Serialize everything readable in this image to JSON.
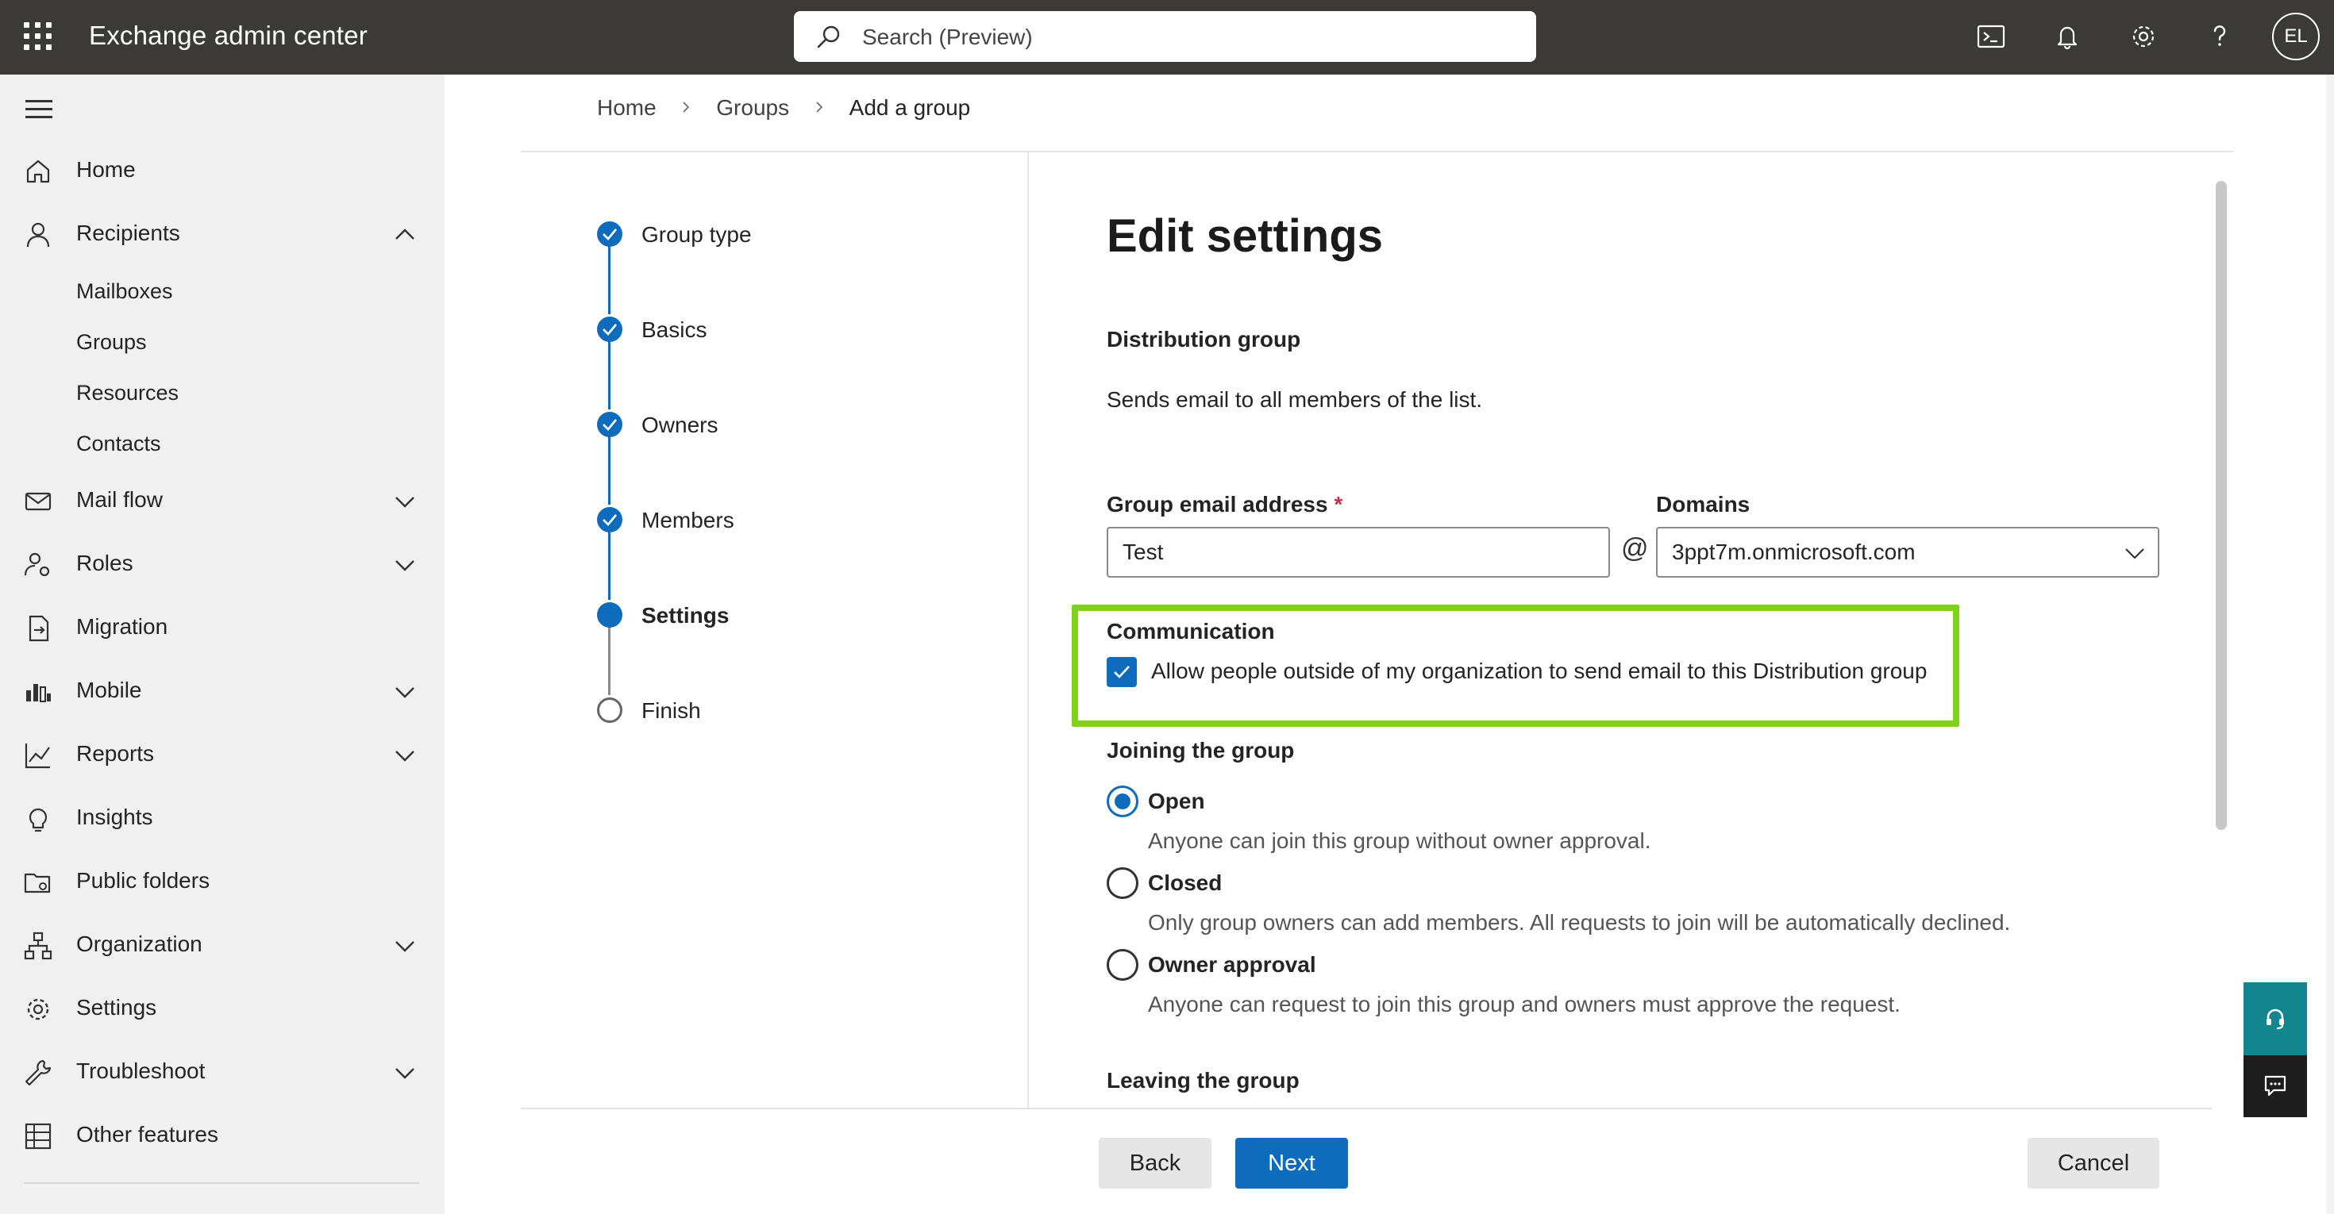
{
  "app": {
    "title": "Exchange admin center",
    "search_placeholder": "Search (Preview)",
    "user_initials": "EL",
    "accent_color": "#0f6cbd",
    "highlight_color": "#7fd11a"
  },
  "topbar_icons": [
    "terminal-icon",
    "bell-icon",
    "gear-icon",
    "help-icon"
  ],
  "sidebar": {
    "items": [
      {
        "label": "Home",
        "icon": "home-icon",
        "expandable": false
      },
      {
        "label": "Recipients",
        "icon": "person-icon",
        "expandable": true,
        "expanded": true,
        "children": [
          "Mailboxes",
          "Groups",
          "Resources",
          "Contacts"
        ]
      },
      {
        "label": "Mail flow",
        "icon": "mail-icon",
        "expandable": true
      },
      {
        "label": "Roles",
        "icon": "roles-icon",
        "expandable": true
      },
      {
        "label": "Migration",
        "icon": "migration-icon",
        "expandable": false
      },
      {
        "label": "Mobile",
        "icon": "mobile-icon",
        "expandable": true
      },
      {
        "label": "Reports",
        "icon": "chart-icon",
        "expandable": true
      },
      {
        "label": "Insights",
        "icon": "lightbulb-icon",
        "expandable": false
      },
      {
        "label": "Public folders",
        "icon": "folder-icon",
        "expandable": false
      },
      {
        "label": "Organization",
        "icon": "org-icon",
        "expandable": true
      },
      {
        "label": "Settings",
        "icon": "gear-icon",
        "expandable": false
      },
      {
        "label": "Troubleshoot",
        "icon": "wrench-icon",
        "expandable": true
      },
      {
        "label": "Other features",
        "icon": "grid-icon",
        "expandable": false
      }
    ]
  },
  "breadcrumb": [
    "Home",
    "Groups",
    "Add a group"
  ],
  "wizard": {
    "steps": [
      {
        "label": "Group type",
        "state": "done"
      },
      {
        "label": "Basics",
        "state": "done"
      },
      {
        "label": "Owners",
        "state": "done"
      },
      {
        "label": "Members",
        "state": "done"
      },
      {
        "label": "Settings",
        "state": "current"
      },
      {
        "label": "Finish",
        "state": "todo"
      }
    ]
  },
  "form": {
    "heading": "Edit settings",
    "group_type_title": "Distribution group",
    "group_type_desc": "Sends email to all members of the list.",
    "email_label": "Group email address",
    "required_mark": "*",
    "email_value": "Test",
    "at_sign": "@",
    "domains_label": "Domains",
    "domain_value": "3ppt7m.onmicrosoft.com",
    "communication_title": "Communication",
    "communication_checkbox": "Allow people outside of my organization to send email to this Distribution group",
    "communication_checked": true,
    "joining_title": "Joining the group",
    "joining_options": [
      {
        "label": "Open",
        "desc": "Anyone can join this group without owner approval.",
        "selected": true
      },
      {
        "label": "Closed",
        "desc": "Only group owners can add members. All requests to join will be automatically declined.",
        "selected": false
      },
      {
        "label": "Owner approval",
        "desc": "Anyone can request to join this group and owners must approve the request.",
        "selected": false
      }
    ],
    "leaving_title": "Leaving the group"
  },
  "footer": {
    "back_label": "Back",
    "next_label": "Next",
    "cancel_label": "Cancel"
  }
}
